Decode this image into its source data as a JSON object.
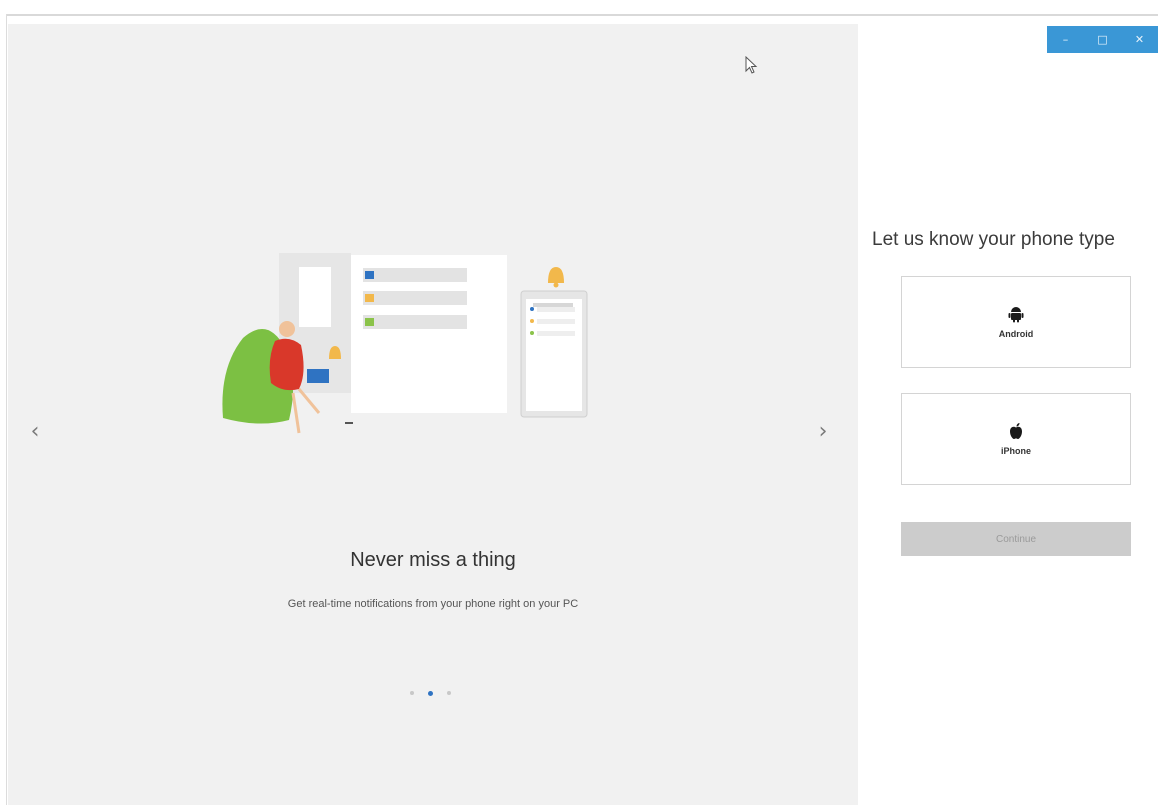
{
  "window": {
    "controls": {
      "minimize": "–",
      "maximize": "□",
      "close": "✕"
    }
  },
  "carousel": {
    "prev_arrow": "‹",
    "next_arrow": "›",
    "slide": {
      "title": "Never miss a thing",
      "subtitle": "Get real-time notifications from your phone right on your PC"
    },
    "pagination": {
      "count": 3,
      "active_index": 1
    }
  },
  "sidebar": {
    "heading": "Let us know your phone type",
    "options": [
      {
        "label": "Android",
        "icon": "android-icon"
      },
      {
        "label": "iPhone",
        "icon": "apple-icon"
      }
    ],
    "continue_label": "Continue"
  },
  "colors": {
    "carousel_bg": "#f1f1f1",
    "accent_blue": "#3a97d6",
    "active_dot": "#2f73c2",
    "disabled_button": "#cccccc"
  }
}
